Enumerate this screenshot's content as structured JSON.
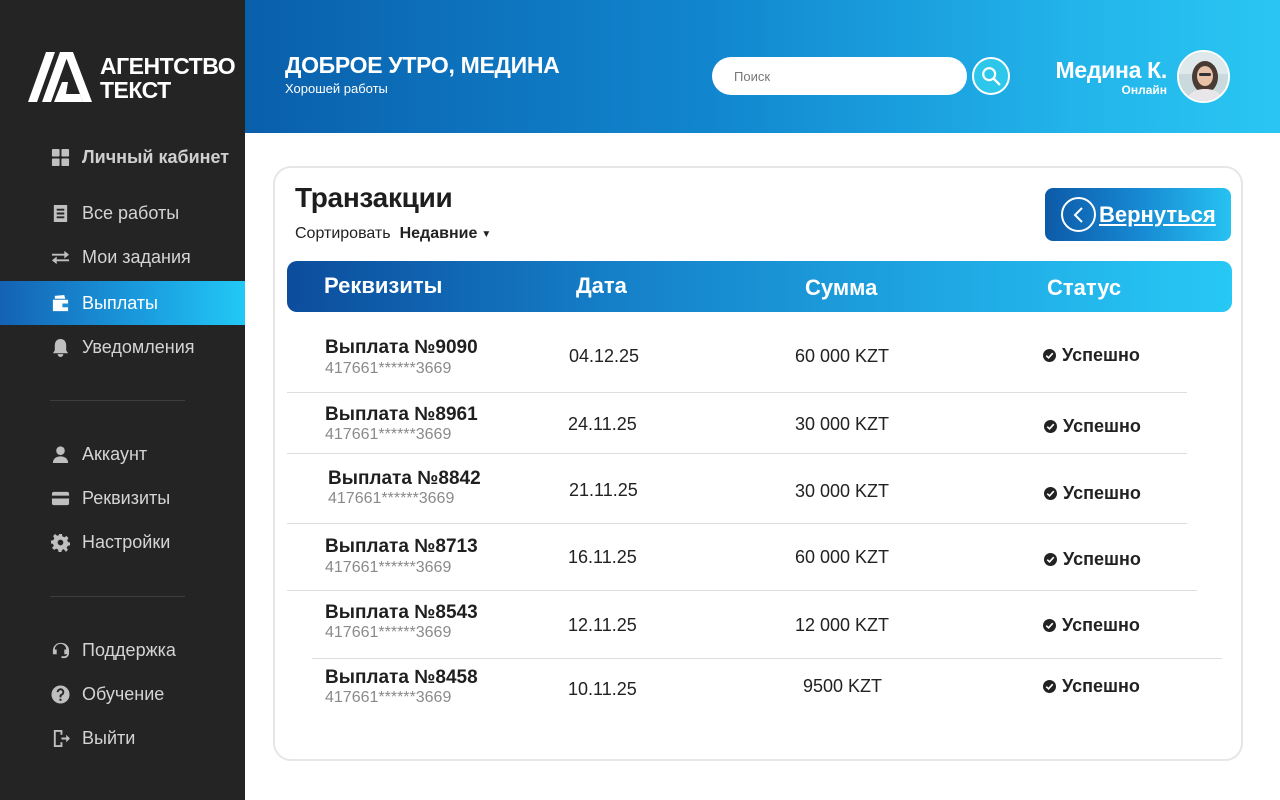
{
  "brand": {
    "line1": "АГЕНТСТВО",
    "line2": "ТЕКСТ"
  },
  "sidebar": {
    "items": [
      {
        "label": "Личный кабинет",
        "icon": "dashboard-icon"
      },
      {
        "label": "Все работы",
        "icon": "document-list-icon"
      },
      {
        "label": "Мои задания",
        "icon": "swap-arrows-icon"
      },
      {
        "label": "Выплаты",
        "icon": "wallet-icon",
        "active": true
      },
      {
        "label": "Уведомления",
        "icon": "bell-icon"
      },
      {
        "label": "Аккаунт",
        "icon": "user-icon"
      },
      {
        "label": "Реквизиты",
        "icon": "credit-card-icon"
      },
      {
        "label": "Настройки",
        "icon": "gear-icon"
      },
      {
        "label": "Поддержка",
        "icon": "headset-icon"
      },
      {
        "label": "Обучение",
        "icon": "question-icon"
      },
      {
        "label": "Выйти",
        "icon": "logout-icon"
      }
    ]
  },
  "header": {
    "title": "ДОБРОЕ УТРО, МЕДИНА",
    "subtitle": "Хорошей работы",
    "search_placeholder": "Поиск",
    "user_name": "Медина К.",
    "user_status": "Онлайн"
  },
  "main": {
    "title": "Транзакции",
    "sort_label": "Сортировать",
    "sort_value": "Недавние",
    "back_label": "Вернуться",
    "columns": [
      "Реквизиты",
      "Дата",
      "Сумма",
      "Статус"
    ],
    "rows": [
      {
        "name": "Выплата №9090",
        "card": "417661******3669",
        "date": "04.12.25",
        "amount": "60 000 KZT",
        "status": "Успешно"
      },
      {
        "name": "Выплата №8961",
        "card": "417661******3669",
        "date": "24.11.25",
        "amount": "30 000 KZT",
        "status": "Успешно"
      },
      {
        "name": "Выплата №8842",
        "card": "417661******3669",
        "date": "21.11.25",
        "amount": "30 000 KZT",
        "status": "Успешно"
      },
      {
        "name": "Выплата №8713",
        "card": "417661******3669",
        "date": "16.11.25",
        "amount": "60 000 KZT",
        "status": "Успешно"
      },
      {
        "name": "Выплата №8543",
        "card": "417661******3669",
        "date": "12.11.25",
        "amount": "12 000 KZT",
        "status": "Успешно"
      },
      {
        "name": "Выплата №8458",
        "card": "417661******3669",
        "date": "10.11.25",
        "amount": "9500 KZT",
        "status": "Успешно"
      }
    ]
  },
  "colors": {
    "accent_dark": "#0c4d9c",
    "accent_light": "#27c8f5",
    "sidebar_bg": "#242424"
  }
}
